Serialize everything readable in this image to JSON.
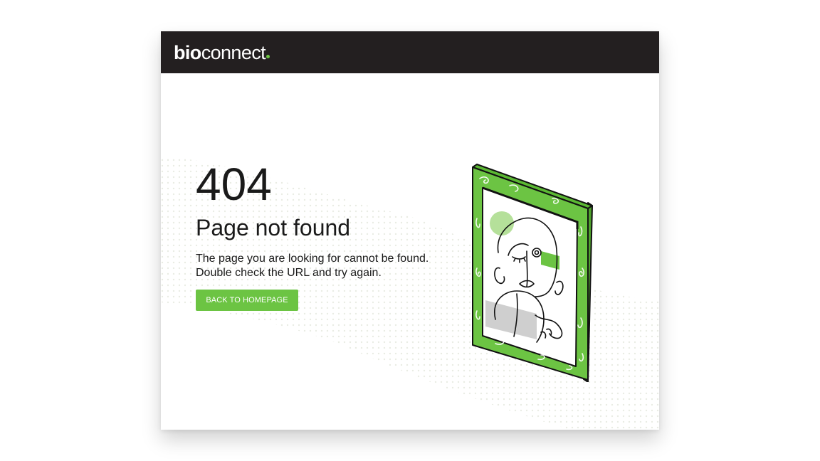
{
  "brand": {
    "logo_bold": "bio",
    "logo_light": "connect",
    "accent_color": "#6cc443",
    "header_bg": "#231f20"
  },
  "error": {
    "code": "404",
    "title": "Page not found",
    "lines": [
      "The page you are looking for cannot be found.",
      "Double check the URL and try again."
    ]
  },
  "cta": {
    "label": "BACK TO HOMEPAGE"
  },
  "illustration": {
    "icon": "framed-portrait-illustration"
  }
}
